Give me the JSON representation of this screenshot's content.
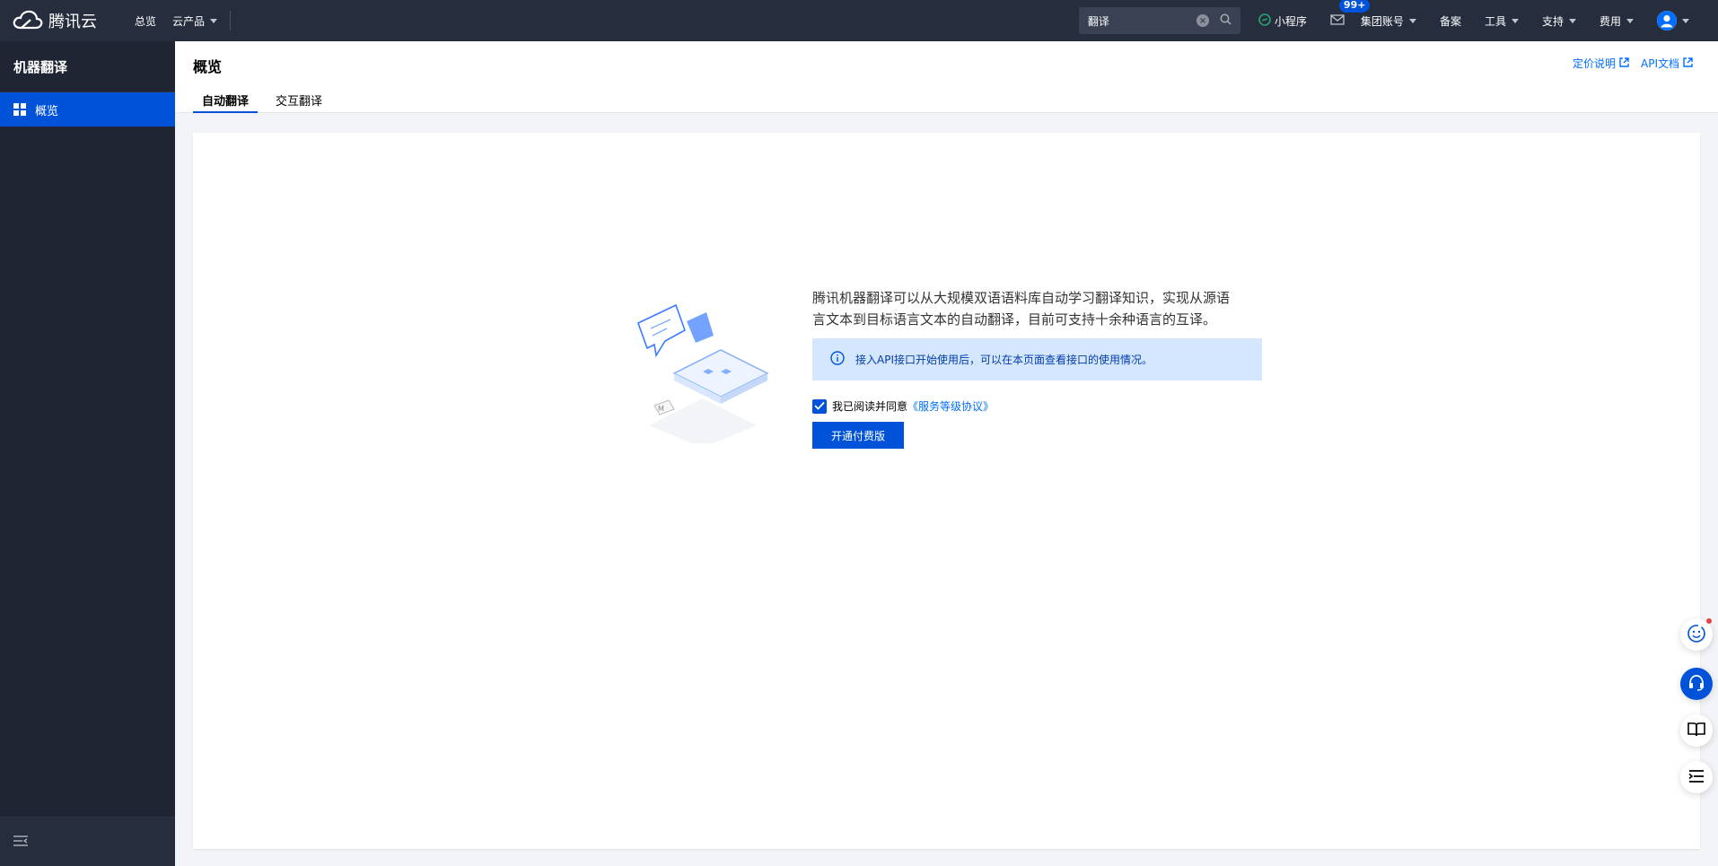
{
  "brand": {
    "name": "腾讯云"
  },
  "topnav": {
    "overview": "总览",
    "products": "云产品",
    "search_value": "翻译",
    "mini_program": "小程序",
    "message_badge": "99+",
    "group_account": "集团账号",
    "filing": "备案",
    "tools": "工具",
    "support": "支持",
    "billing": "费用"
  },
  "sidebar": {
    "title": "机器翻译",
    "items": [
      {
        "label": "概览",
        "active": true
      }
    ]
  },
  "header": {
    "title": "概览",
    "links": {
      "pricing": "定价说明",
      "api_docs": "API文档"
    },
    "tabs": [
      {
        "label": "自动翻译",
        "active": true
      },
      {
        "label": "交互翻译",
        "active": false
      }
    ]
  },
  "main": {
    "intro_line1": "腾讯机器翻译可以从大规模双语语料库自动学习翻译知识，实现从源语",
    "intro_line2": "言文本到目标语言文本的自动翻译，目前可支持十余种语言的互译。",
    "info": "接入API接口开始使用后，可以在本页面查看接口的使用情况。",
    "agree_prefix": "我已阅读并同意",
    "agree_link": "《服务等级协议》",
    "agree_checked": true,
    "primary_button": "开通付费版"
  },
  "colors": {
    "primary": "#0052d9",
    "topbar": "#262d3d",
    "sidebar": "#1f2533",
    "link": "#006eff",
    "info_bg": "#d5e7ff"
  },
  "icons": [
    "cloud-logo-icon",
    "clear-icon",
    "search-icon",
    "mini-program-icon",
    "mail-icon",
    "user-icon",
    "dashboard-icon",
    "collapse-icon",
    "external-link-icon",
    "info-icon",
    "check-icon",
    "smile-icon",
    "headset-icon",
    "book-icon",
    "list-icon"
  ]
}
